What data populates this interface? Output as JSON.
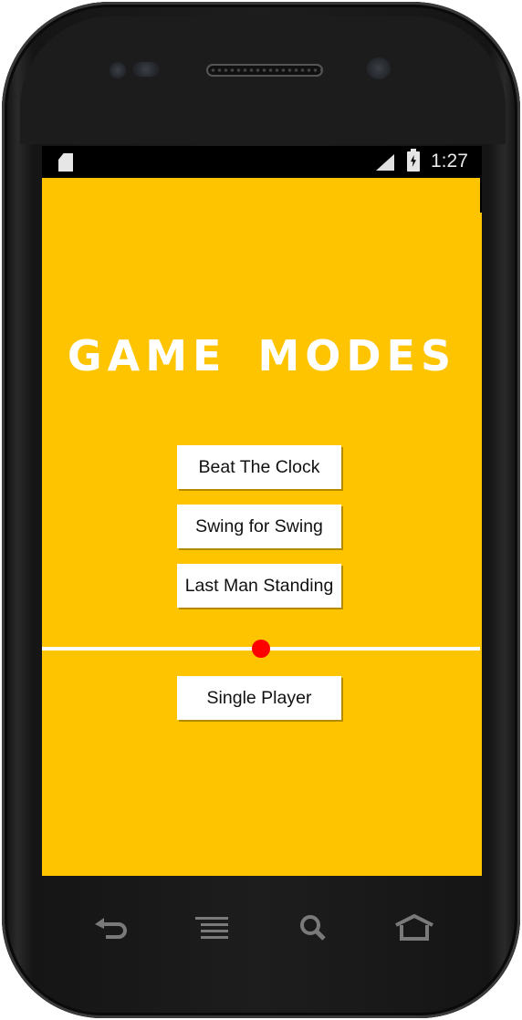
{
  "status_bar": {
    "time": "1:27",
    "icons": [
      "sd-card-icon",
      "signal-icon",
      "battery-charging-icon"
    ]
  },
  "screen": {
    "title": "GAME MODES",
    "mode_buttons": [
      {
        "label": "Beat The Clock"
      },
      {
        "label": "Swing for Swing"
      },
      {
        "label": "Last Man Standing"
      }
    ],
    "slider": {
      "value_percent": 50
    },
    "player_button": {
      "label": "Single Player"
    }
  },
  "nav_bar": {
    "buttons": [
      "back-icon",
      "menu-icon",
      "search-icon",
      "home-icon"
    ]
  },
  "colors": {
    "background": "#fec400",
    "button": "#ffffff",
    "slider_track": "#ffffff",
    "slider_thumb": "#ff0000",
    "title": "#ffffff"
  }
}
